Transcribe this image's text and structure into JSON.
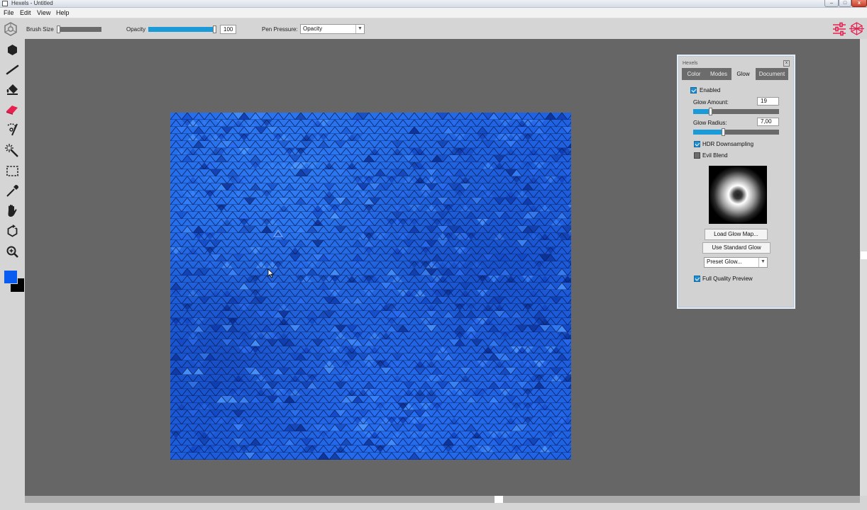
{
  "window": {
    "title": "Hexels - Untitled",
    "minimize": "–",
    "maximize": "□",
    "close": "x"
  },
  "menu": [
    {
      "label": "File"
    },
    {
      "label": "Edit"
    },
    {
      "label": "View"
    },
    {
      "label": "Help"
    }
  ],
  "options": {
    "brush_size_label": "Brush Size",
    "brush_size_percent": 0,
    "opacity_label": "Opacity",
    "opacity_value": "100",
    "opacity_percent": 100,
    "pen_pressure_label": "Pen Pressure:",
    "pen_pressure_value": "Opacity",
    "dropdown_arrow": "▼"
  },
  "tools": [
    {
      "name": "hexel-fill-tool",
      "icon": "hexagon-icon"
    },
    {
      "name": "line-tool",
      "icon": "line-icon"
    },
    {
      "name": "paint-bucket-tool",
      "icon": "paint-bucket-icon"
    },
    {
      "name": "eraser-tool",
      "icon": "eraser-icon",
      "color": "#e8204f"
    },
    {
      "name": "lasso-tool",
      "icon": "lasso-icon"
    },
    {
      "name": "magic-wand-tool",
      "icon": "magic-wand-icon"
    },
    {
      "name": "marquee-tool",
      "icon": "marquee-icon"
    },
    {
      "name": "eyedropper-tool",
      "icon": "eyedropper-icon"
    },
    {
      "name": "hand-tool",
      "icon": "hand-icon"
    },
    {
      "name": "rotate-tool",
      "icon": "rotate-icon"
    },
    {
      "name": "zoom-tool",
      "icon": "zoom-icon"
    }
  ],
  "colors": {
    "primary": "#0a5cf0",
    "secondary": "#000000",
    "accent": "#1a9ad6",
    "toolbar_accent": "#e8204f",
    "canvas_base": "#1f63e5"
  },
  "panel": {
    "title": "Hexels",
    "close_glyph": "x",
    "tabs": [
      {
        "label": "Color",
        "active": false
      },
      {
        "label": "Modes",
        "active": false
      },
      {
        "label": "Glow",
        "active": true
      },
      {
        "label": "Document",
        "active": false
      }
    ],
    "enabled": {
      "label": "Enabled",
      "checked": true
    },
    "glow_amount": {
      "label": "Glow Amount:",
      "value": "19",
      "percent": 20
    },
    "glow_radius": {
      "label": "Glow Radius:",
      "value": "7,00",
      "percent": 35
    },
    "hdr_downsampling": {
      "label": "HDR Downsampling",
      "checked": true
    },
    "evil_blend": {
      "label": "Evil Blend",
      "checked": false
    },
    "load_glow_map": "Load Glow Map...",
    "use_standard_glow": "Use Standard Glow",
    "preset_glow": "Preset Glow...",
    "full_quality_preview": {
      "label": "Full Quality Preview",
      "checked": true
    }
  }
}
